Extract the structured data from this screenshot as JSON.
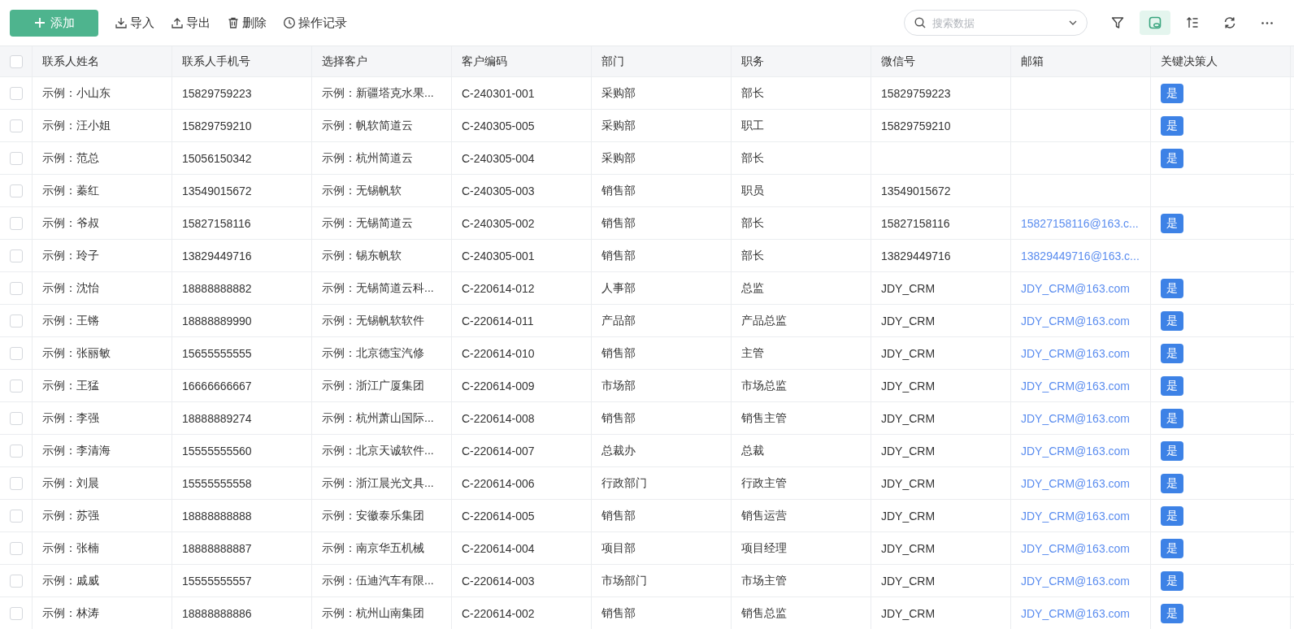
{
  "toolbar": {
    "add_button": "添加",
    "actions": [
      {
        "kind": "import",
        "label": "导入"
      },
      {
        "kind": "export",
        "label": "导出"
      },
      {
        "kind": "delete",
        "label": "删除"
      },
      {
        "kind": "history",
        "label": "操作记录"
      }
    ],
    "search": {
      "placeholder": "搜索数据"
    },
    "tools": [
      {
        "kind": "filter",
        "selected": false
      },
      {
        "kind": "view",
        "selected": true
      },
      {
        "kind": "sort",
        "selected": false
      },
      {
        "kind": "refresh",
        "selected": false
      },
      {
        "kind": "more",
        "selected": false
      }
    ]
  },
  "table": {
    "select_all": {
      "checked": false
    },
    "columns": [
      "联系人姓名",
      "联系人手机号",
      "选择客户",
      "客户编码",
      "部门",
      "职务",
      "微信号",
      "邮箱",
      "关键决策人"
    ],
    "rows": [
      {
        "checked": false,
        "name": "示例：小山东",
        "phone": "15829759223",
        "customer": "示例：新疆塔克水果...",
        "code": "C-240301-001",
        "department": "采购部",
        "position": "部长",
        "wechat": "15829759223",
        "key_decision": "是"
      },
      {
        "checked": false,
        "name": "示例：汪小姐",
        "phone": "15829759210",
        "customer": "示例：帆软简道云",
        "code": "C-240305-005",
        "department": "采购部",
        "position": "职工",
        "wechat": "15829759210",
        "key_decision": "是"
      },
      {
        "checked": false,
        "name": "示例：范总",
        "phone": "15056150342",
        "customer": "示例：杭州简道云",
        "code": "C-240305-004",
        "department": "采购部",
        "position": "部长",
        "key_decision": "是"
      },
      {
        "checked": false,
        "name": "示例：蓁红",
        "phone": "13549015672",
        "customer": "示例：无锡帆软",
        "code": "C-240305-003",
        "department": "销售部",
        "position": "职员",
        "wechat": "13549015672"
      },
      {
        "checked": false,
        "name": "示例：爷叔",
        "phone": "15827158116",
        "customer": "示例：无锡简道云",
        "code": "C-240305-002",
        "department": "销售部",
        "position": "部长",
        "wechat": "15827158116",
        "email": "15827158116@163.c...",
        "key_decision": "是"
      },
      {
        "checked": false,
        "name": "示例：玲子",
        "phone": "13829449716",
        "customer": "示例：锡东帆软",
        "code": "C-240305-001",
        "department": "销售部",
        "position": "部长",
        "wechat": "13829449716",
        "email": "13829449716@163.c..."
      },
      {
        "checked": false,
        "name": "示例：沈怡",
        "phone": "18888888882",
        "customer": "示例：无锡简道云科...",
        "code": "C-220614-012",
        "department": "人事部",
        "position": "总监",
        "wechat": "JDY_CRM",
        "email": "JDY_CRM@163.com",
        "key_decision": "是"
      },
      {
        "checked": false,
        "name": "示例：王锵",
        "phone": "18888889990",
        "customer": "示例：无锡帆软软件",
        "code": "C-220614-011",
        "department": "产品部",
        "position": "产品总监",
        "wechat": "JDY_CRM",
        "email": "JDY_CRM@163.com",
        "key_decision": "是"
      },
      {
        "checked": false,
        "name": "示例：张丽敏",
        "phone": "15655555555",
        "customer": "示例：北京德宝汽修",
        "code": "C-220614-010",
        "department": "销售部",
        "position": "主管",
        "wechat": "JDY_CRM",
        "email": "JDY_CRM@163.com",
        "key_decision": "是"
      },
      {
        "checked": false,
        "name": "示例：王猛",
        "phone": "16666666667",
        "customer": "示例：浙江广厦集团",
        "code": "C-220614-009",
        "department": "市场部",
        "position": "市场总监",
        "wechat": "JDY_CRM",
        "email": "JDY_CRM@163.com",
        "key_decision": "是"
      },
      {
        "checked": false,
        "name": "示例：李强",
        "phone": "18888889274",
        "customer": "示例：杭州萧山国际...",
        "code": "C-220614-008",
        "department": "销售部",
        "position": "销售主管",
        "wechat": "JDY_CRM",
        "email": "JDY_CRM@163.com",
        "key_decision": "是"
      },
      {
        "checked": false,
        "name": "示例：李清海",
        "phone": "15555555560",
        "customer": "示例：北京天诚软件...",
        "code": "C-220614-007",
        "department": "总裁办",
        "position": "总裁",
        "wechat": "JDY_CRM",
        "email": "JDY_CRM@163.com",
        "key_decision": "是"
      },
      {
        "checked": false,
        "name": "示例：刘晨",
        "phone": "15555555558",
        "customer": "示例：浙江晨光文具...",
        "code": "C-220614-006",
        "department": "行政部门",
        "position": "行政主管",
        "wechat": "JDY_CRM",
        "email": "JDY_CRM@163.com",
        "key_decision": "是"
      },
      {
        "checked": false,
        "name": "示例：苏强",
        "phone": "18888888888",
        "customer": "示例：安徽泰乐集团",
        "code": "C-220614-005",
        "department": "销售部",
        "position": "销售运营",
        "wechat": "JDY_CRM",
        "email": "JDY_CRM@163.com",
        "key_decision": "是"
      },
      {
        "checked": false,
        "name": "示例：张楠",
        "phone": "18888888887",
        "customer": "示例：南京华五机械",
        "code": "C-220614-004",
        "department": "项目部",
        "position": "项目经理",
        "wechat": "JDY_CRM",
        "email": "JDY_CRM@163.com",
        "key_decision": "是"
      },
      {
        "checked": false,
        "name": "示例：戚威",
        "phone": "15555555557",
        "customer": "示例：伍迪汽车有限...",
        "code": "C-220614-003",
        "department": "市场部门",
        "position": "市场主管",
        "wechat": "JDY_CRM",
        "email": "JDY_CRM@163.com",
        "key_decision": "是"
      },
      {
        "checked": false,
        "name": "示例：林涛",
        "phone": "18888888886",
        "customer": "示例：杭州山南集团",
        "code": "C-220614-002",
        "department": "销售部",
        "position": "销售总监",
        "wechat": "JDY_CRM",
        "email": "JDY_CRM@163.com",
        "key_decision": "是"
      }
    ]
  }
}
